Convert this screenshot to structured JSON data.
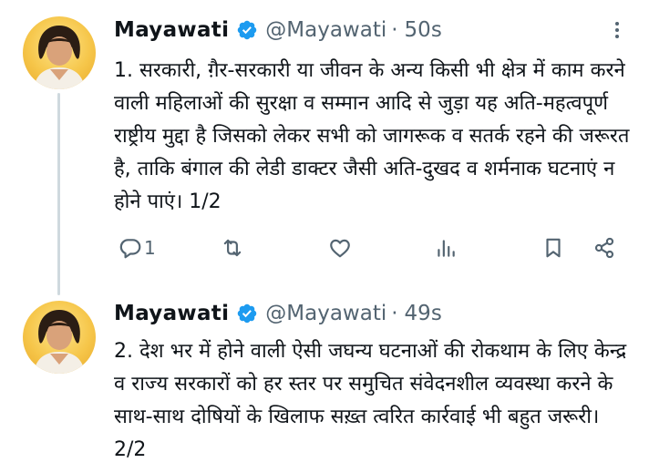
{
  "tweets": [
    {
      "author_name": "Mayawati",
      "handle": "@Mayawati",
      "separator": "·",
      "time": "50s",
      "text": "1. सरकारी, ग़ैर-सरकारी या जीवन के अन्य किसी भी क्षेत्र में काम करने वाली महिलाओं की सुरक्षा व सम्मान आदि से जुड़ा यह अति-महत्वपूर्ण राष्ट्रीय मुद्दा है जिसको लेकर सभी को जागरूक व सतर्क रहने की जरूरत है, ताकि बंगाल की लेडी डाक्टर जैसी अति-दुखद व शर्मनाक घटनाएं न होने पाएं। 1/2",
      "reply_count": "1"
    },
    {
      "author_name": "Mayawati",
      "handle": "@Mayawati",
      "separator": "·",
      "time": "49s",
      "text": "2. देश भर में होने वाली ऐसी जघन्य घटनाओं की रोकथाम के लिए केन्द्र व राज्य सरकारों को हर स्तर पर समुचित संवेदनशील व्यवस्था करने के साथ-साथ दोषियों के खिलाफ सख़्त त्वरित कार्रवाई भी बहुत जरूरी। 2/2"
    }
  ],
  "icons": {
    "verified": "verified-badge-icon",
    "more": "more-options-icon",
    "reply": "reply-icon",
    "retweet": "retweet-icon",
    "like": "heart-icon",
    "views": "views-bar-chart-icon",
    "bookmark": "bookmark-icon",
    "share": "share-icon"
  },
  "colors": {
    "verified_blue": "#1d9bf0",
    "secondary_text": "#536471",
    "thread_line": "#cfd9de",
    "primary_text": "#0f1419"
  }
}
